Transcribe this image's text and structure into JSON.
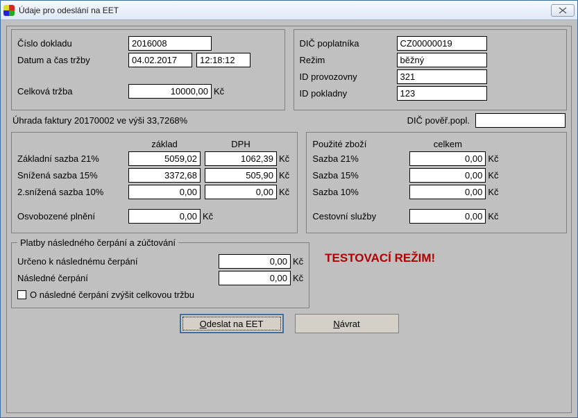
{
  "window": {
    "title": "Údaje pro odeslání na EET"
  },
  "doc": {
    "cisloDokladu_label": "Číslo dokladu",
    "cisloDokladu": "2016008",
    "datumCas_label": "Datum a čas tržby",
    "datum": "04.02.2017",
    "cas": "12:18:12",
    "celkovaTrzba_label": "Celková tržba",
    "celkovaTrzba": "10000,00"
  },
  "pokl": {
    "dicPoplatnika_label": "DIČ poplatníka",
    "dicPoplatnika": "CZ00000019",
    "rezim_label": "Režim",
    "rezim": "běžný",
    "idProvozovny_label": "ID provozovny",
    "idProvozovny": "321",
    "idPokladny_label": "ID pokladny",
    "idPokladny": "123"
  },
  "status": {
    "uhrada": "Úhrada faktury 20170002 ve výši 33,7268%",
    "dicPover_label": "DIČ pověř.popl.",
    "dicPover": ""
  },
  "tax": {
    "h_zaklad": "základ",
    "h_dph": "DPH",
    "r21_label": "Základní sazba 21%",
    "r21_zaklad": "5059,02",
    "r21_dph": "1062,39",
    "r15_label": "Snížená sazba 15%",
    "r15_zaklad": "3372,68",
    "r15_dph": "505,90",
    "r10_label": "2.snížená sazba 10%",
    "r10_zaklad": "0,00",
    "r10_dph": "0,00",
    "osv_label": "Osvobozené plnění",
    "osv": "0,00"
  },
  "goods": {
    "h1": "Použité zboží",
    "h2": "celkem",
    "s21_label": "Sazba 21%",
    "s21": "0,00",
    "s15_label": "Sazba 15%",
    "s15": "0,00",
    "s10_label": "Sazba 10%",
    "s10": "0,00",
    "cest_label": "Cestovní služby",
    "cest": "0,00"
  },
  "follow": {
    "legend": "Platby následného čerpání a zúčtování",
    "urceno_label": "Určeno k následnému čerpání",
    "urceno": "0,00",
    "nasledne_label": "Následné čerpání",
    "nasledne": "0,00",
    "chk_label": "O následné čerpání zvýšit celkovou tržbu"
  },
  "testmode": "TESTOVACÍ REŽIM!",
  "buttons": {
    "send": "Odeslat na EET",
    "back": "Návrat"
  },
  "kc": "Kč"
}
